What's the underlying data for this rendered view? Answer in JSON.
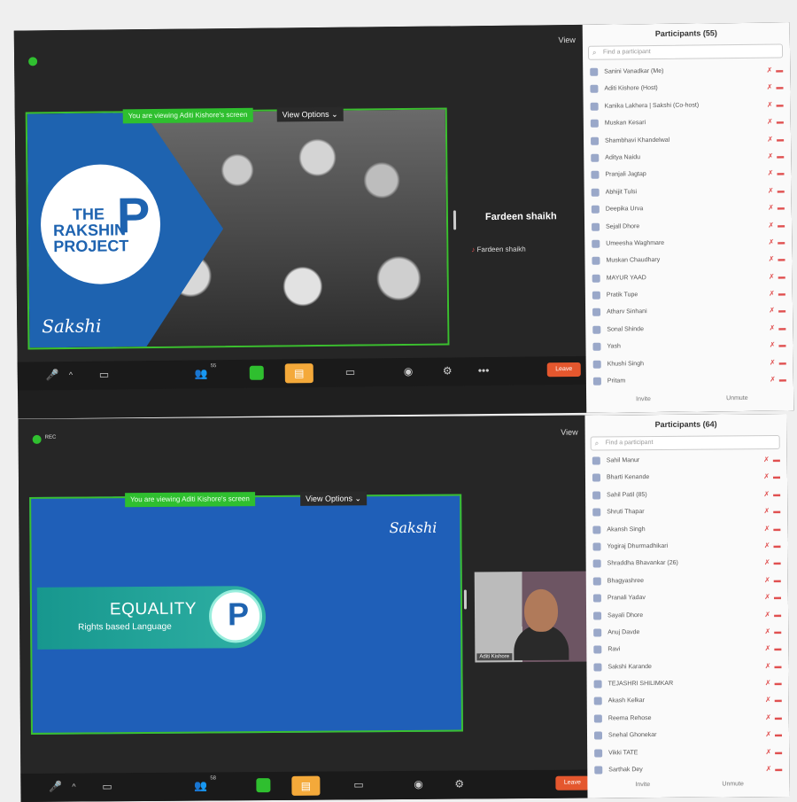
{
  "shot1": {
    "view_label": "View",
    "viewing_banner": "You are viewing Aditi Kishore's screen",
    "view_options": "View Options",
    "slide": {
      "logo_text": "THE RAKSHIN PROJECT",
      "logo_letter": "P",
      "brand": "Sakshi"
    },
    "speaker": {
      "name_large": "Fardeen shaikh",
      "name_small": "Fardeen shaikh"
    },
    "toolbar": {
      "participants_count": "55",
      "leave": "Leave",
      "chat_icon": "chat-icon"
    },
    "panel": {
      "title": "Participants (55)",
      "search_placeholder": "Find a participant",
      "participants": [
        "Sanini Vanadkar (Me)",
        "Aditi Kishore (Host)",
        "Kanika Lakhera | Sakshi (Co-host)",
        "Muskan Kesari",
        "Shambhavi Khandelwal",
        "Aditya Naidu",
        "Pranjali Jagtap",
        "Abhijit Tulsi",
        "Deepika Urva",
        "Sejall Dhore",
        "Umeesha Waghmare",
        "Muskan Chaudhary",
        "MAYUR YAAD",
        "Pratik Tupe",
        "Atharv Sinhani",
        "Sonal Shinde",
        "Yash",
        "Khushi Singh",
        "Pritam"
      ],
      "invite": "Invite",
      "unmute": "Unmute"
    }
  },
  "shot2": {
    "view_label": "View",
    "rec_label": "REC",
    "viewing_banner": "You are viewing Aditi Kishore's screen",
    "view_options": "View Options",
    "slide": {
      "title": "EQUALITY",
      "subtitle": "Rights based Language",
      "brand": "Sakshi",
      "logo_letter": "P"
    },
    "camera_name": "Aditi Kishore",
    "toolbar": {
      "participants_count": "58",
      "leave": "Leave",
      "chat_icon": "chat-icon"
    },
    "panel": {
      "title": "Participants (64)",
      "search_placeholder": "Find a participant",
      "participants": [
        "Sahil Manur",
        "Bharti Kenande",
        "Sahil Patil (85)",
        "Shruti Thapar",
        "Akansh Singh",
        "Yogiraj Dhurmadhikari",
        "Shraddha Bhavankar (26)",
        "Bhagyashree",
        "Pranali Yadav",
        "Sayali Dhore",
        "Anuj Davde",
        "Ravi",
        "Sakshi Karande",
        "TEJASHRI SHILIMKAR",
        "Akash Kelkar",
        "Reema Rehose",
        "Snehal Ghonekar",
        "Vikki TATE",
        "Sarthak Dey"
      ],
      "invite": "Invite",
      "unmute": "Unmute"
    }
  },
  "colors": {
    "zoom_green": "#3bbf2f",
    "slide_blue": "#1e63b0",
    "leave_red": "#e4572e",
    "chat_orange": "#f4a93a"
  }
}
